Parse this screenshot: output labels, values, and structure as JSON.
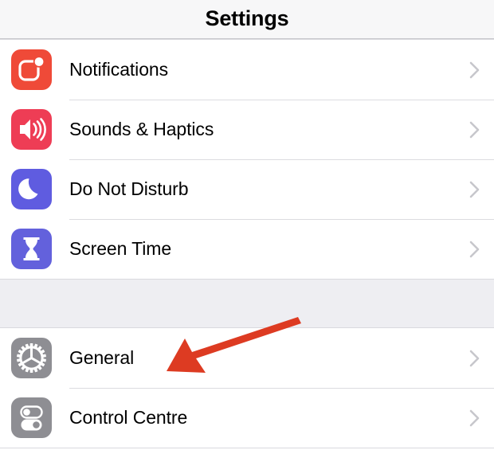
{
  "navbar": {
    "title": "Settings"
  },
  "colors": {
    "notifications_icon": "#ef4a38",
    "sounds_icon": "#ee3d55",
    "do_not_disturb_icon": "#5f5ce0",
    "screen_time_icon": "#6361dc",
    "general_icon": "#8e8e93",
    "control_centre_icon": "#8e8e93",
    "chevron": "#c7c7cc",
    "annotation_arrow": "#dd3b22",
    "row_background": "#ffffff",
    "group_gap_background": "#eeeef2",
    "navbar_background": "#f7f7f8",
    "separator": "#dcdce0",
    "label_text": "#000000"
  },
  "groups": [
    {
      "name": "primary-settings-group",
      "rows": [
        {
          "label": "Notifications",
          "icon": "notifications-icon",
          "accessory": "chevron-right-icon"
        },
        {
          "label": "Sounds & Haptics",
          "icon": "sounds-haptics-icon",
          "accessory": "chevron-right-icon"
        },
        {
          "label": "Do Not Disturb",
          "icon": "do-not-disturb-icon",
          "accessory": "chevron-right-icon"
        },
        {
          "label": "Screen Time",
          "icon": "screen-time-icon",
          "accessory": "chevron-right-icon"
        }
      ]
    },
    {
      "name": "system-settings-group",
      "rows": [
        {
          "label": "General",
          "icon": "general-gear-icon",
          "accessory": "chevron-right-icon"
        },
        {
          "label": "Control Centre",
          "icon": "control-centre-icon",
          "accessory": "chevron-right-icon"
        }
      ]
    }
  ],
  "annotation": {
    "type": "arrow",
    "points_to": "General",
    "color": "#dd3b22"
  }
}
